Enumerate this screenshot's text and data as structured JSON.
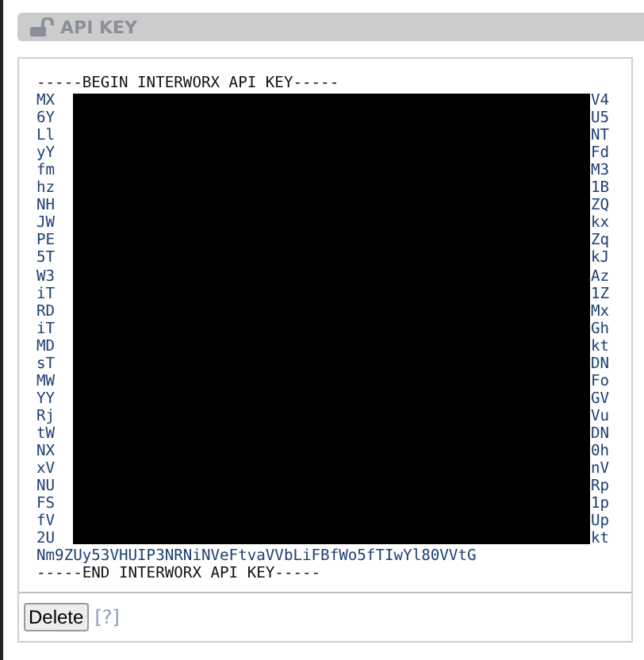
{
  "section": {
    "title": "API KEY",
    "locked": false
  },
  "key": {
    "begin": "-----BEGIN INTERWORX API KEY-----",
    "lines": [
      {
        "start": "MX",
        "end": "V4"
      },
      {
        "start": "6Y",
        "end": "U5"
      },
      {
        "start": "Ll",
        "end": "NT"
      },
      {
        "start": "yY",
        "end": "Fd"
      },
      {
        "start": "fm",
        "end": "M3"
      },
      {
        "start": "hz",
        "end": "1B"
      },
      {
        "start": "NH",
        "end": "ZQ"
      },
      {
        "start": "JW",
        "end": "kx"
      },
      {
        "start": "PE",
        "end": "Zq"
      },
      {
        "start": "5T",
        "end": "kJ"
      },
      {
        "start": "W3",
        "end": "Az"
      },
      {
        "start": "iT",
        "end": "1Z"
      },
      {
        "start": "RD",
        "end": "Mx"
      },
      {
        "start": "iT",
        "end": "Gh"
      },
      {
        "start": "MD",
        "end": "kt"
      },
      {
        "start": "sT",
        "end": "DN"
      },
      {
        "start": "MW",
        "end": "Fo"
      },
      {
        "start": "YY",
        "end": "GV"
      },
      {
        "start": "Rj",
        "end": "Vu"
      },
      {
        "start": "tW",
        "end": "DN"
      },
      {
        "start": "NX",
        "end": "0h"
      },
      {
        "start": "xV",
        "end": "nV"
      },
      {
        "start": "NU",
        "end": "Rp"
      },
      {
        "start": "FS",
        "end": "1p"
      },
      {
        "start": "fV",
        "end": "Up"
      },
      {
        "start": "2U",
        "end": "kt"
      }
    ],
    "last": "Nm9ZUy53VHUIP3NRNiNVeFtvaVVbLiFBfWo5fTIwYl80VVtG",
    "end": "-----END INTERWORX API KEY-----"
  },
  "buttons": [
    {
      "label": "Delete"
    }
  ],
  "help": "[?]"
}
